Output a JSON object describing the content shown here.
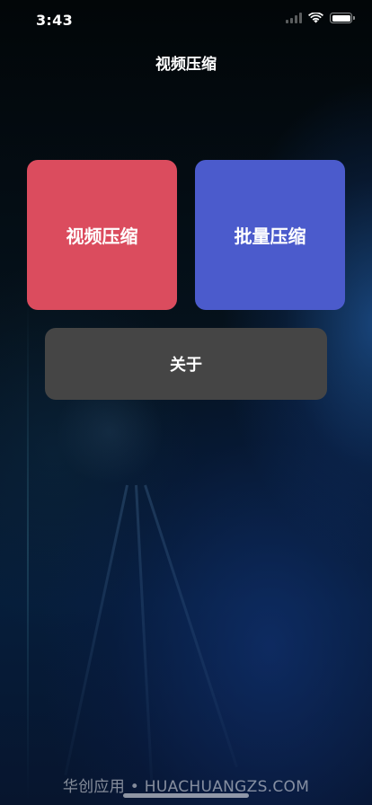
{
  "status_bar": {
    "time": "3:43",
    "icons": [
      "signal-icon",
      "wifi-icon",
      "battery-icon"
    ]
  },
  "nav": {
    "title": "视频压缩"
  },
  "tiles": {
    "compress": {
      "label": "视频压缩",
      "color": "#db4c5e"
    },
    "batch": {
      "label": "批量压缩",
      "color": "#4b5bcc"
    }
  },
  "about": {
    "label": "关于",
    "color": "#454545"
  },
  "watermark": {
    "text": "华创应用 • HUACHUANGZS.COM"
  }
}
